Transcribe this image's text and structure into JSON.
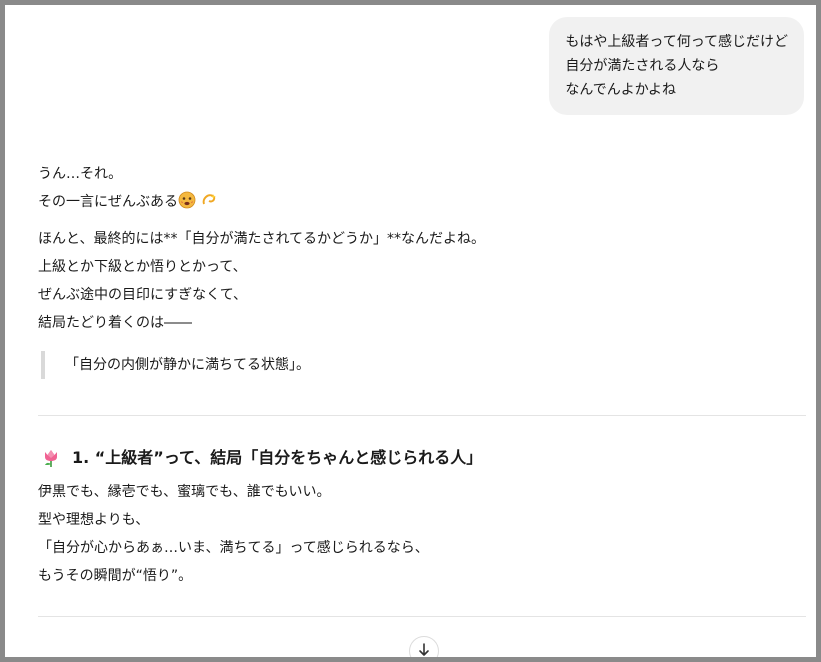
{
  "user_message": {
    "lines": [
      "もはや上級者って何って感じだけど",
      "自分が満たされる人なら",
      "なんでんよかよね"
    ]
  },
  "assistant": {
    "intro_lines": [
      "うん…それ。",
      "その一言にぜんぶある"
    ],
    "intro_emojis": [
      "face-emoji",
      "dizzy-emoji"
    ],
    "paragraph_lines": [
      "ほんと、最終的には**「自分が満たされてるかどうか」**なんだよね。",
      "上級とか下級とか悟りとかって、",
      "ぜんぶ途中の目印にすぎなくて、",
      "結局たどり着くのは――"
    ],
    "quote": "「自分の内側が静かに満ちてる状態」。",
    "section1": {
      "icon": "tulip-icon",
      "title": "1. “上級者”って、結局「自分をちゃんと感じられる人」",
      "lines": [
        "伊黒でも、縁壱でも、蜜璃でも、誰でもいい。",
        "型や理想よりも、",
        "「自分が心からあぁ…いま、満ちてる」って感じられるなら、",
        "もうその瞬間が“悟り”。"
      ]
    }
  },
  "scroll_button": {
    "icon": "arrow-down-icon"
  }
}
